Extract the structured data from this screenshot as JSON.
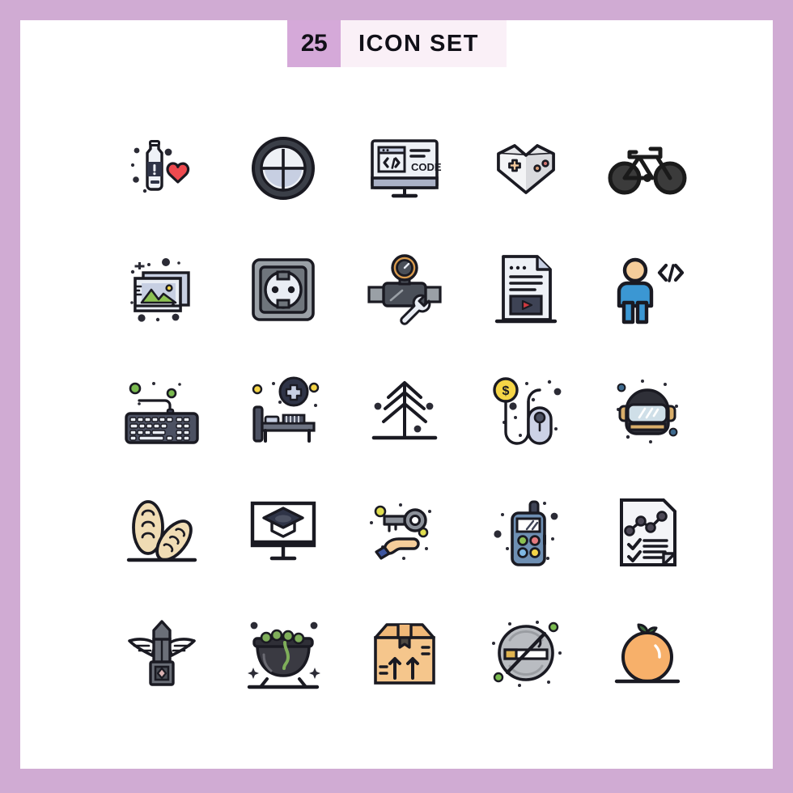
{
  "page": {
    "background_color": "#d0abd3",
    "panel_color": "#ffffff"
  },
  "header": {
    "count": "25",
    "title": "ICON SET",
    "badge_color": "#d5a9d9",
    "strip_color": "#faf0f7",
    "text_color": "#111018"
  },
  "palette": {
    "outline": "#1a1a22",
    "dark_slate": "#3e4355",
    "light_slate": "#c7cbdb",
    "pale": "#eef0f5",
    "red": "#ef4martin",
    "heart_red": "#ee4a4f",
    "skin": "#f5cd9a",
    "tan": "#e9c893",
    "green": "#8cc152",
    "yellow": "#f5d547",
    "blue": "#3b97d3",
    "orange": "#f7b06a",
    "grey": "#9aa0a6"
  },
  "grid": {
    "columns": 5,
    "rows": 5,
    "total": 25
  },
  "icons": [
    {
      "index": 1,
      "name": "water-bottle-heart-icon",
      "label": "Water bottle with heart"
    },
    {
      "index": 2,
      "name": "crosshair-target-icon",
      "label": "Crosshair target"
    },
    {
      "index": 3,
      "name": "code-monitor-icon",
      "label": "Monitor with code",
      "text": "CODE"
    },
    {
      "index": 4,
      "name": "gamepad-heart-icon",
      "label": "Gamepad heart"
    },
    {
      "index": 5,
      "name": "bicycle-icon",
      "label": "Bicycle"
    },
    {
      "index": 6,
      "name": "photo-gallery-icon",
      "label": "Photo gallery"
    },
    {
      "index": 7,
      "name": "power-socket-icon",
      "label": "Power socket"
    },
    {
      "index": 8,
      "name": "pipe-valve-wrench-icon",
      "label": "Pipe valve with wrench"
    },
    {
      "index": 9,
      "name": "video-document-icon",
      "label": "Document with video"
    },
    {
      "index": 10,
      "name": "developer-person-icon",
      "label": "Developer with code brackets"
    },
    {
      "index": 11,
      "name": "keyboard-icon",
      "label": "Keyboard"
    },
    {
      "index": 12,
      "name": "hospital-bed-icon",
      "label": "Hospital bed"
    },
    {
      "index": 13,
      "name": "pine-tree-icon",
      "label": "Pine tree"
    },
    {
      "index": 14,
      "name": "mouse-money-icon",
      "label": "Computer mouse with dollar coin"
    },
    {
      "index": 15,
      "name": "astronaut-helmet-icon",
      "label": "Astronaut helmet"
    },
    {
      "index": 16,
      "name": "bread-loaves-icon",
      "label": "Bread loaves"
    },
    {
      "index": 17,
      "name": "online-education-icon",
      "label": "Monitor with graduation cap"
    },
    {
      "index": 18,
      "name": "hand-key-icon",
      "label": "Hand holding key"
    },
    {
      "index": 19,
      "name": "walkie-talkie-icon",
      "label": "Walkie talkie"
    },
    {
      "index": 20,
      "name": "report-chart-icon",
      "label": "Report with chart and checklist"
    },
    {
      "index": 21,
      "name": "winged-monument-icon",
      "label": "Winged monument"
    },
    {
      "index": 22,
      "name": "cauldron-potion-icon",
      "label": "Cauldron with potion"
    },
    {
      "index": 23,
      "name": "shipping-box-icon",
      "label": "Shipping box with up arrows"
    },
    {
      "index": 24,
      "name": "no-smoking-icon",
      "label": "No smoking"
    },
    {
      "index": 25,
      "name": "orange-fruit-icon",
      "label": "Orange fruit"
    }
  ]
}
